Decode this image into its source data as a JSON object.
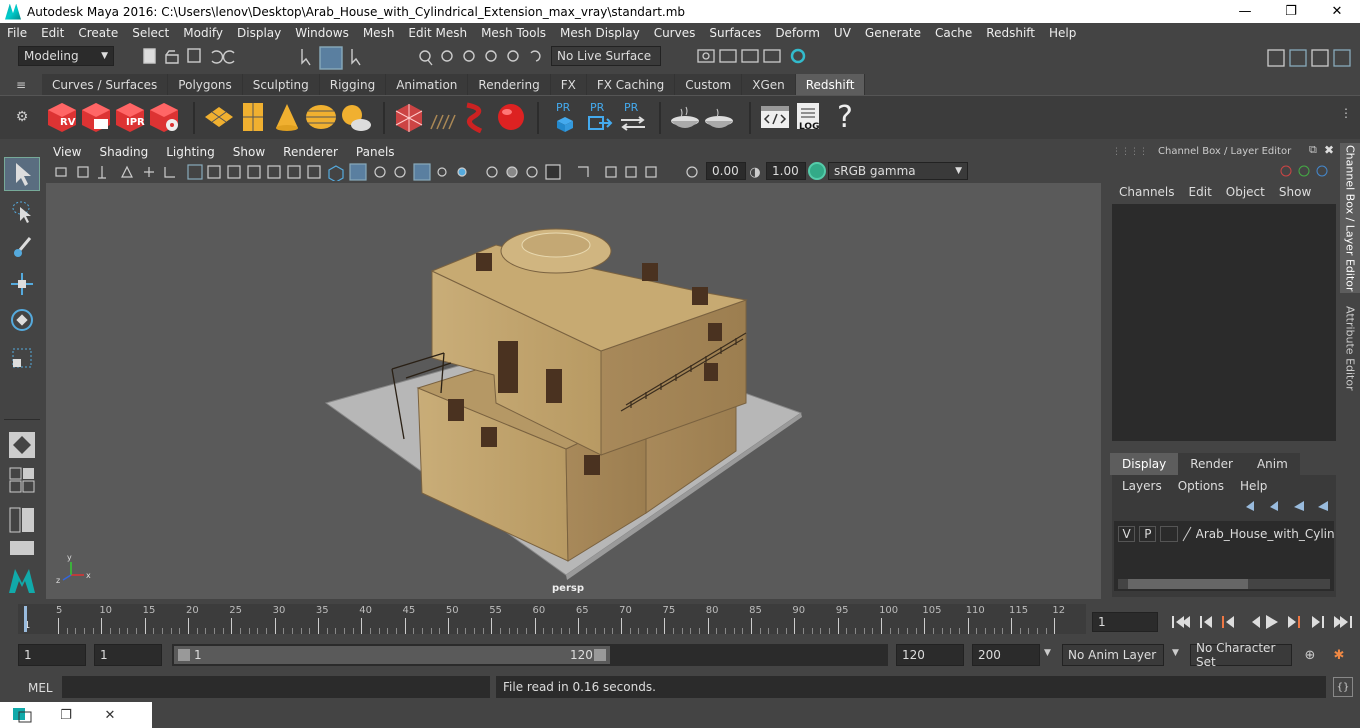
{
  "window": {
    "title": "Autodesk Maya 2016: C:\\Users\\lenov\\Desktop\\Arab_House_with_Cylindrical_Extension_max_vray\\standart.mb",
    "minimize": "—",
    "maximize": "❐",
    "close": "✕"
  },
  "menus": [
    "File",
    "Edit",
    "Create",
    "Select",
    "Modify",
    "Display",
    "Windows",
    "Mesh",
    "Edit Mesh",
    "Mesh Tools",
    "Mesh Display",
    "Curves",
    "Surfaces",
    "Deform",
    "UV",
    "Generate",
    "Cache",
    "Redshift",
    "Help"
  ],
  "status": {
    "mode": "Modeling",
    "live_surface": "No Live Surface"
  },
  "shelf_tabs": [
    "Curves / Surfaces",
    "Polygons",
    "Sculpting",
    "Rigging",
    "Animation",
    "Rendering",
    "FX",
    "FX Caching",
    "Custom",
    "XGen",
    "Redshift"
  ],
  "shelf_active": "Redshift",
  "shelf_labels": {
    "rv": "RV",
    "ipr": "IPR",
    "pr": "PR",
    "log": "LOG",
    "help": "?"
  },
  "viewport": {
    "menus": [
      "View",
      "Shading",
      "Lighting",
      "Show",
      "Renderer",
      "Panels"
    ],
    "exposure": "0.00",
    "gamma": "1.00",
    "colorspace": "sRGB gamma",
    "camera": "persp",
    "axis_x": "x",
    "axis_y": "y",
    "axis_z": "z"
  },
  "channel_box": {
    "title": "Channel Box / Layer Editor",
    "menus": [
      "Channels",
      "Edit",
      "Object",
      "Show"
    ],
    "layer_tabs": [
      "Display",
      "Render",
      "Anim"
    ],
    "layer_menus": [
      "Layers",
      "Options",
      "Help"
    ],
    "layer": {
      "v": "V",
      "p": "P",
      "name": "Arab_House_with_Cylinc"
    }
  },
  "side_tabs": {
    "channel_box": "Channel Box / Layer Editor",
    "attribute_editor": "Attribute Editor"
  },
  "timeline": {
    "ticks": [
      "5",
      "10",
      "15",
      "20",
      "25",
      "30",
      "35",
      "40",
      "45",
      "50",
      "55",
      "60",
      "65",
      "70",
      "75",
      "80",
      "85",
      "90",
      "95",
      "100",
      "105",
      "110",
      "115",
      "12"
    ],
    "start_marker": "1",
    "current_frame": "1"
  },
  "range": {
    "start": "1",
    "playback_start": "1",
    "slider_start": "1",
    "slider_end": "120",
    "playback_end": "120",
    "end": "200",
    "anim_layer": "No Anim Layer",
    "character_set": "No Character Set"
  },
  "command": {
    "language": "MEL",
    "message": "File read in  0.16 seconds."
  }
}
